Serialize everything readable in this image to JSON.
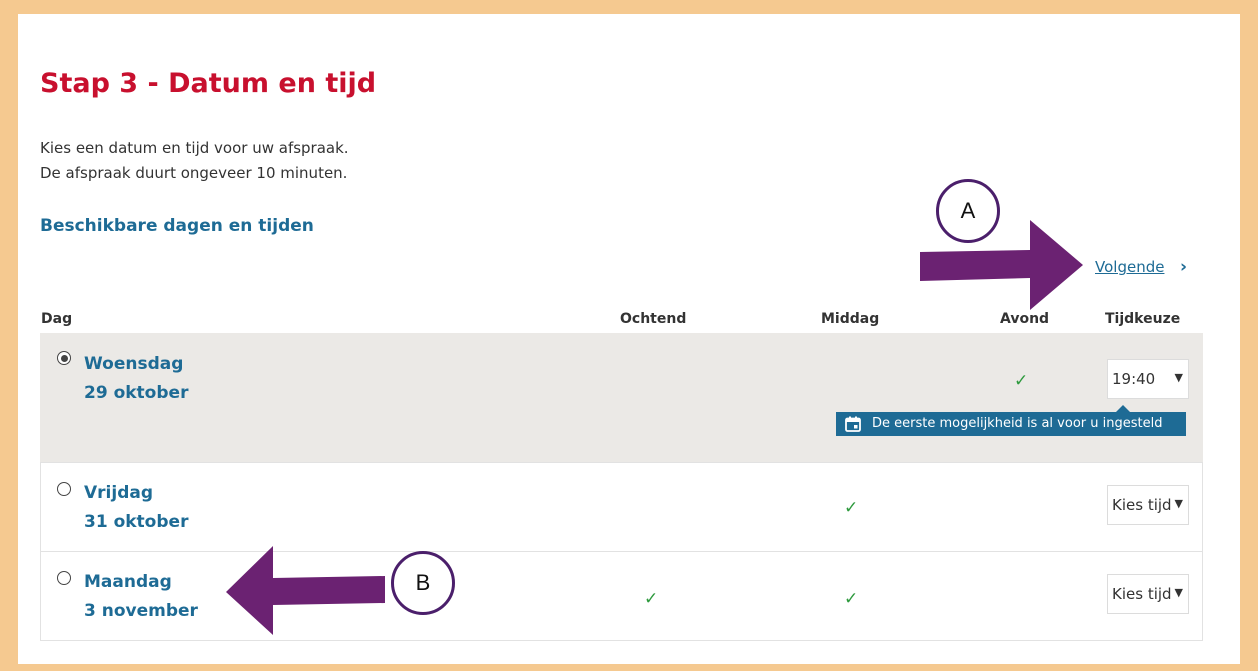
{
  "colors": {
    "frame": "#f5c990",
    "title": "#c8102e",
    "link": "#1e6b95",
    "selected_row": "#ebe9e6",
    "check": "#2e9a3e",
    "arrow": "#6b2272"
  },
  "page": {
    "title": "Stap 3 - Datum en tijd",
    "intro_line1": "Kies een datum en tijd voor uw afspraak.",
    "intro_line2": "De afspraak duurt ongeveer 10 minuten.",
    "subtitle": "Beschikbare dagen en tijden",
    "next_label": "Volgende",
    "next_icon": "chevron-right-icon"
  },
  "table": {
    "headers": {
      "dag": "Dag",
      "ochtend": "Ochtend",
      "middag": "Middag",
      "avond": "Avond",
      "tijdkeuze": "Tijdkeuze"
    },
    "rows": [
      {
        "day": "Woensdag",
        "date": "29 oktober",
        "selected": true,
        "ochtend": false,
        "middag": false,
        "avond": true,
        "time": "19:40"
      },
      {
        "day": "Vrijdag",
        "date": "31 oktober",
        "selected": false,
        "ochtend": false,
        "middag": true,
        "avond": false,
        "time": "Kies tijd"
      },
      {
        "day": "Maandag",
        "date": "3 november",
        "selected": false,
        "ochtend": true,
        "middag": true,
        "avond": false,
        "time": "Kies tijd"
      }
    ],
    "check_symbol": "✓",
    "select_chevron": "⌄"
  },
  "tooltip": {
    "icon": "calendar-icon",
    "text": "De eerste mogelijkheid is al voor u ingesteld"
  },
  "annotations": {
    "a_label": "A",
    "b_label": "B"
  }
}
